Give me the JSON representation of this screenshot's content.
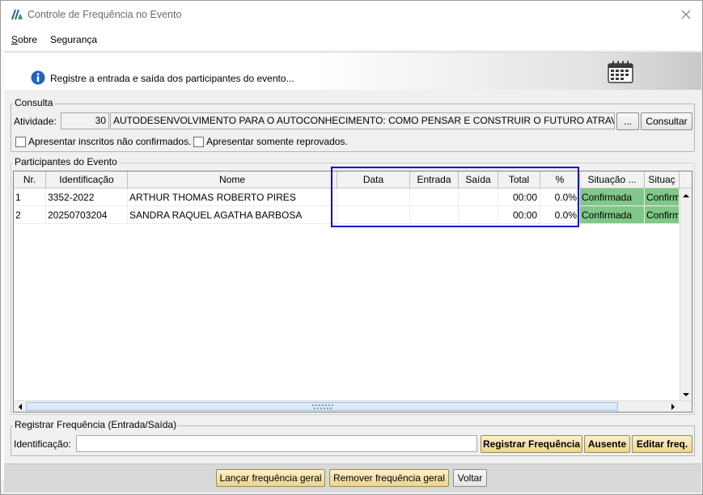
{
  "window": {
    "title": "Controle de Frequência no Evento"
  },
  "menu": {
    "items": [
      {
        "label": "Sobre",
        "mnemonic": "S",
        "rest": "obre"
      },
      {
        "label": "Segurança"
      }
    ]
  },
  "banner": {
    "text": "Registre a entrada e saída dos participantes do evento..."
  },
  "consulta": {
    "title": "Consulta",
    "atividade_label": "Atividade:",
    "atividade_code": "30",
    "atividade_name": "AUTODESENVOLVIMENTO PARA O AUTOCONHECIMENTO: COMO PENSAR E CONSTRUIR O FUTURO ATRAVÉS DE NO",
    "browse_label": "...",
    "consultar_label": "Consultar",
    "check_nao_confirmados": "Apresentar inscritos não confirmados.",
    "check_reprovados": "Apresentar somente reprovados."
  },
  "participantes": {
    "title": "Participantes do Evento",
    "columns": [
      "Nr.",
      "Identificação",
      "Nome",
      "Data",
      "Entrada",
      "Saída",
      "Total",
      "%",
      "Situação ...",
      "Situaç"
    ],
    "rows": [
      {
        "nr": "1",
        "id": "3352-2022",
        "nome": "ARTHUR THOMAS ROBERTO PIRES",
        "data": "",
        "entrada": "",
        "saida": "",
        "total": "00:00",
        "pct": "0.0%",
        "situacao": "Confirmada",
        "situacao2": "Confirm"
      },
      {
        "nr": "2",
        "id": "20250703204",
        "nome": "SANDRA RAQUEL AGATHA BARBOSA",
        "data": "",
        "entrada": "",
        "saida": "",
        "total": "00:00",
        "pct": "0.0%",
        "situacao": "Confirmada",
        "situacao2": "Confirm"
      }
    ]
  },
  "registrar": {
    "title": "Registrar Frequência (Entrada/Saída)",
    "id_label": "Identificação:",
    "id_value": "",
    "registrar_label": "Registrar Frequência",
    "ausente_label": "Ausente",
    "editar_label": "Editar freq."
  },
  "footer": {
    "lancar_label": "Lançar frequência geral",
    "remover_label": "Remover frequência geral",
    "voltar_label": "Voltar"
  },
  "colors": {
    "confirmada_bg": "#80c788",
    "highlight": "#0a0ad8",
    "gold_button": "#ecd58c"
  }
}
